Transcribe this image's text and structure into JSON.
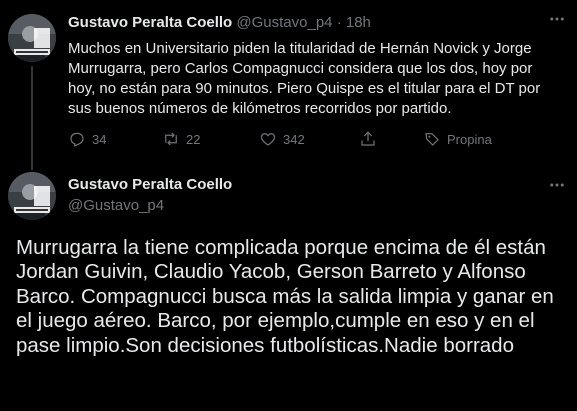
{
  "tweet1": {
    "author_name": "Gustavo Peralta Coello",
    "handle": "@Gustavo_p4",
    "separator": "·",
    "time": "18h",
    "text": "Muchos en Universitario piden la titularidad de Hernán Novick y Jorge Murrugarra, pero Carlos Compagnucci considera que los dos, hoy por hoy, no están para 90 minutos. Piero Quispe es el titular para el DT por sus buenos números de kilómetros recorridos por partido.",
    "replies": "34",
    "retweets": "22",
    "likes": "342",
    "tip_label": "Propina"
  },
  "tweet2": {
    "author_name": "Gustavo Peralta Coello",
    "handle": "@Gustavo_p4",
    "text": "Murrugarra la tiene complicada porque encima de él están Jordan Guivin, Claudio Yacob, Gerson Barreto y Alfonso Barco. Compagnucci busca más la salida limpia y ganar en el juego aéreo. Barco, por ejemplo,cumple en eso y en el pase limpio.Son decisiones futbolísticas.Nadie borrado"
  },
  "icons": {
    "reply": "reply-icon",
    "retweet": "retweet-icon",
    "like": "like-icon",
    "share": "share-icon",
    "tip": "tip-icon",
    "more": "more-icon"
  },
  "colors": {
    "background": "#000000",
    "text": "#e7e9ea",
    "muted": "#71767b",
    "thread_line": "#333639"
  }
}
